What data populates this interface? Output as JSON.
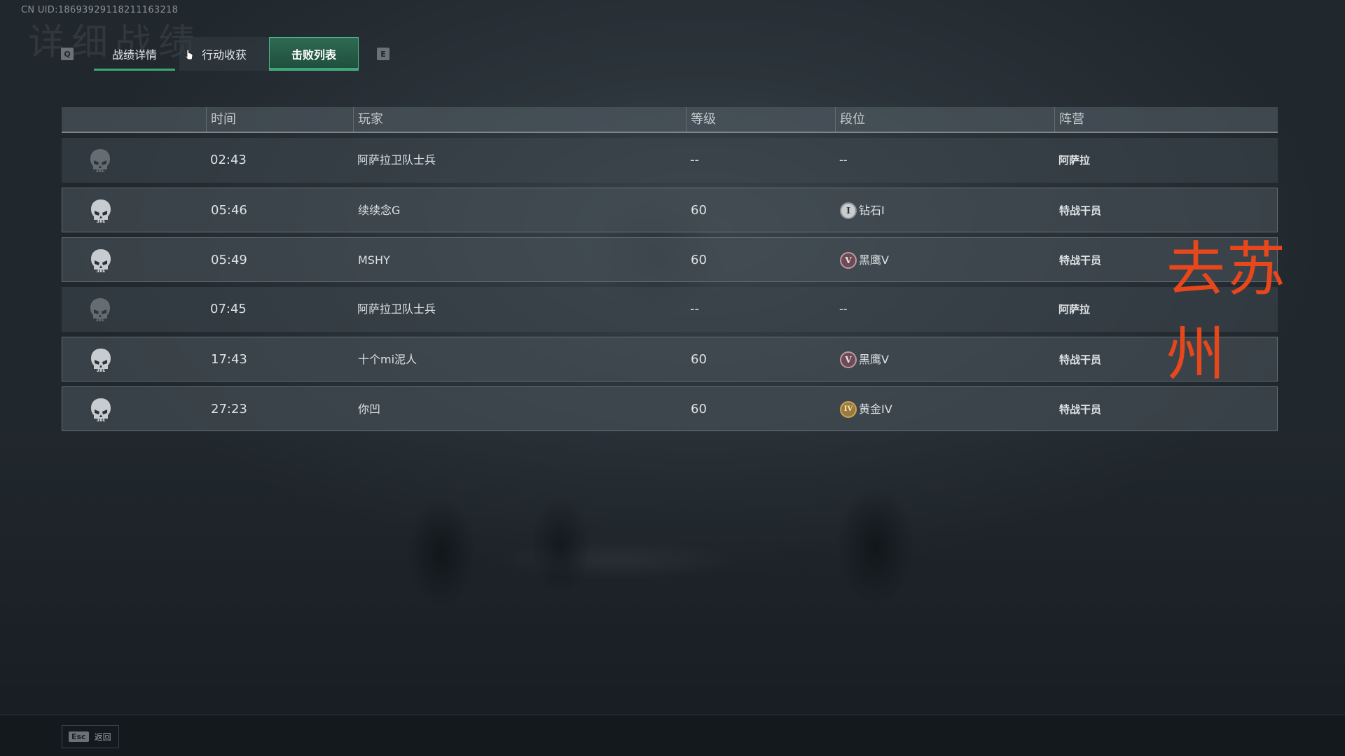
{
  "uid": "CN UID:18693929118211163218",
  "ghost_title": "详细战绩",
  "tabs": {
    "prev_key": "Q",
    "next_key": "E",
    "items": [
      {
        "label": "战绩详情"
      },
      {
        "label": "行动收获"
      },
      {
        "label": "击败列表"
      }
    ],
    "active_index": 2
  },
  "table": {
    "headers": {
      "time": "时间",
      "player": "玩家",
      "level": "等级",
      "rank": "段位",
      "faction": "阵营"
    },
    "rows": [
      {
        "icon": "faded-skull-icon",
        "time": "02:43",
        "player": "阿萨拉卫队士兵",
        "level": "--",
        "rank_badge": "",
        "rank": "--",
        "faction": "阿萨拉"
      },
      {
        "icon": "skull-icon",
        "time": "05:46",
        "player": "续续念G",
        "level": "60",
        "rank_badge": "I",
        "rank": "钻石I",
        "faction": "特战干员"
      },
      {
        "icon": "skull-icon",
        "time": "05:49",
        "player": "MSHY",
        "level": "60",
        "rank_badge": "V",
        "rank": "黑鹰V",
        "faction": "特战干员"
      },
      {
        "icon": "faded-skull-icon",
        "time": "07:45",
        "player": "阿萨拉卫队士兵",
        "level": "--",
        "rank_badge": "",
        "rank": "--",
        "faction": "阿萨拉"
      },
      {
        "icon": "skull-icon",
        "time": "17:43",
        "player": "十个mi泥人",
        "level": "60",
        "rank_badge": "V",
        "rank": "黑鹰V",
        "faction": "特战干员"
      },
      {
        "icon": "skull-icon",
        "time": "27:23",
        "player": "你凹",
        "level": "60",
        "rank_badge": "IV",
        "rank": "黄金IV",
        "faction": "特战干员"
      }
    ]
  },
  "watermark": "去苏州",
  "footer": {
    "esc_key": "Esc",
    "back_label": "返回"
  },
  "colors": {
    "accent_green": "#3ea77a",
    "watermark_red": "#e8471b"
  }
}
